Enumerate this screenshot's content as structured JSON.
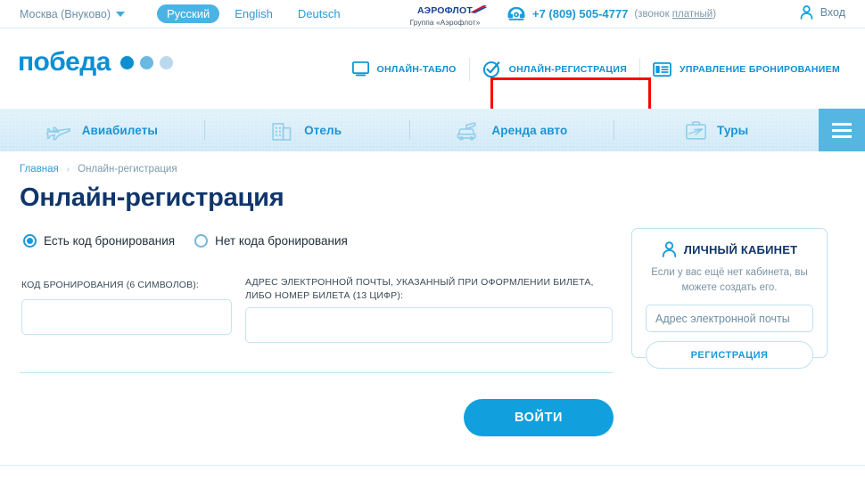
{
  "topbar": {
    "city": "Москва (Внуково)",
    "city_caret_icon": "chevron-down-icon",
    "languages": [
      {
        "label": "Русский",
        "active": true
      },
      {
        "label": "English",
        "active": false
      },
      {
        "label": "Deutsch",
        "active": false
      }
    ],
    "aeroflot": {
      "line1": "АЭРОФЛОТ",
      "line2": "Группа «Аэрофлот»",
      "wing_icon": "aeroflot-wing-icon"
    },
    "phone_icon": "phone-icon",
    "phone": "+7 (809) 505-4777",
    "phone_note_prefix": "(звонок ",
    "phone_note_link": "платный",
    "phone_note_suffix": ")",
    "login_icon": "user-icon",
    "login": "Вход"
  },
  "header": {
    "logo_text": "победа",
    "logo_dots": 3,
    "nav": [
      {
        "label": "ОНЛАЙН-ТАБЛО",
        "icon": "monitor-icon",
        "highlighted": false
      },
      {
        "label": "ОНЛАЙН-РЕГИСТРАЦИЯ",
        "icon": "check-circle-icon",
        "highlighted": true
      },
      {
        "label": "УПРАВЛЕНИЕ БРОНИРОВАНИЕМ",
        "icon": "card-list-icon",
        "highlighted": false
      }
    ]
  },
  "servicenav": {
    "items": [
      {
        "label": "Авиабилеты",
        "icon": "airplane-icon"
      },
      {
        "label": "Отель",
        "icon": "building-icon"
      },
      {
        "label": "Аренда авто",
        "icon": "car-icon"
      },
      {
        "label": "Туры",
        "icon": "suitcase-icon"
      }
    ],
    "menu_button_icon": "hamburger-menu-icon"
  },
  "breadcrumb": {
    "home": "Главная",
    "separator": "›",
    "current": "Онлайн-регистрация"
  },
  "main": {
    "title": "Онлайн-регистрация",
    "radios": [
      {
        "label": "Есть код бронирования",
        "selected": true
      },
      {
        "label": "Нет кода бронирования",
        "selected": false
      }
    ],
    "fields": [
      {
        "label": "КОД БРОНИРОВАНИЯ (6 СИМВОЛОВ):",
        "value": "",
        "placeholder": ""
      },
      {
        "label": "АДРЕС ЭЛЕКТРОННОЙ ПОЧТЫ, УКАЗАННЫЙ ПРИ ОФОРМЛЕНИИ БИЛЕТА, ЛИБО НОМЕР БИЛЕТА (13 ЦИФР):",
        "value": "",
        "placeholder": ""
      }
    ],
    "submit_label": "ВОЙТИ"
  },
  "cabinet": {
    "icon": "user-icon",
    "title": "ЛИЧНЫЙ КАБИНЕТ",
    "subtitle": "Если у вас ещё нет кабинета, вы можете создать его.",
    "email_placeholder": "Адрес электронной почты",
    "email_value": "",
    "register_label": "РЕГИСТРАЦИЯ"
  },
  "colors": {
    "brand_blue": "#0b8ed2",
    "accent_blue": "#11a0dd",
    "title_navy": "#10366b",
    "highlight_red": "#fa0000",
    "nav_bg_top": "#e3f2fa",
    "nav_bg_bottom": "#cfe9f7",
    "burger_bg": "#56b6e2",
    "border_light_blue": "#bfe1f3"
  }
}
